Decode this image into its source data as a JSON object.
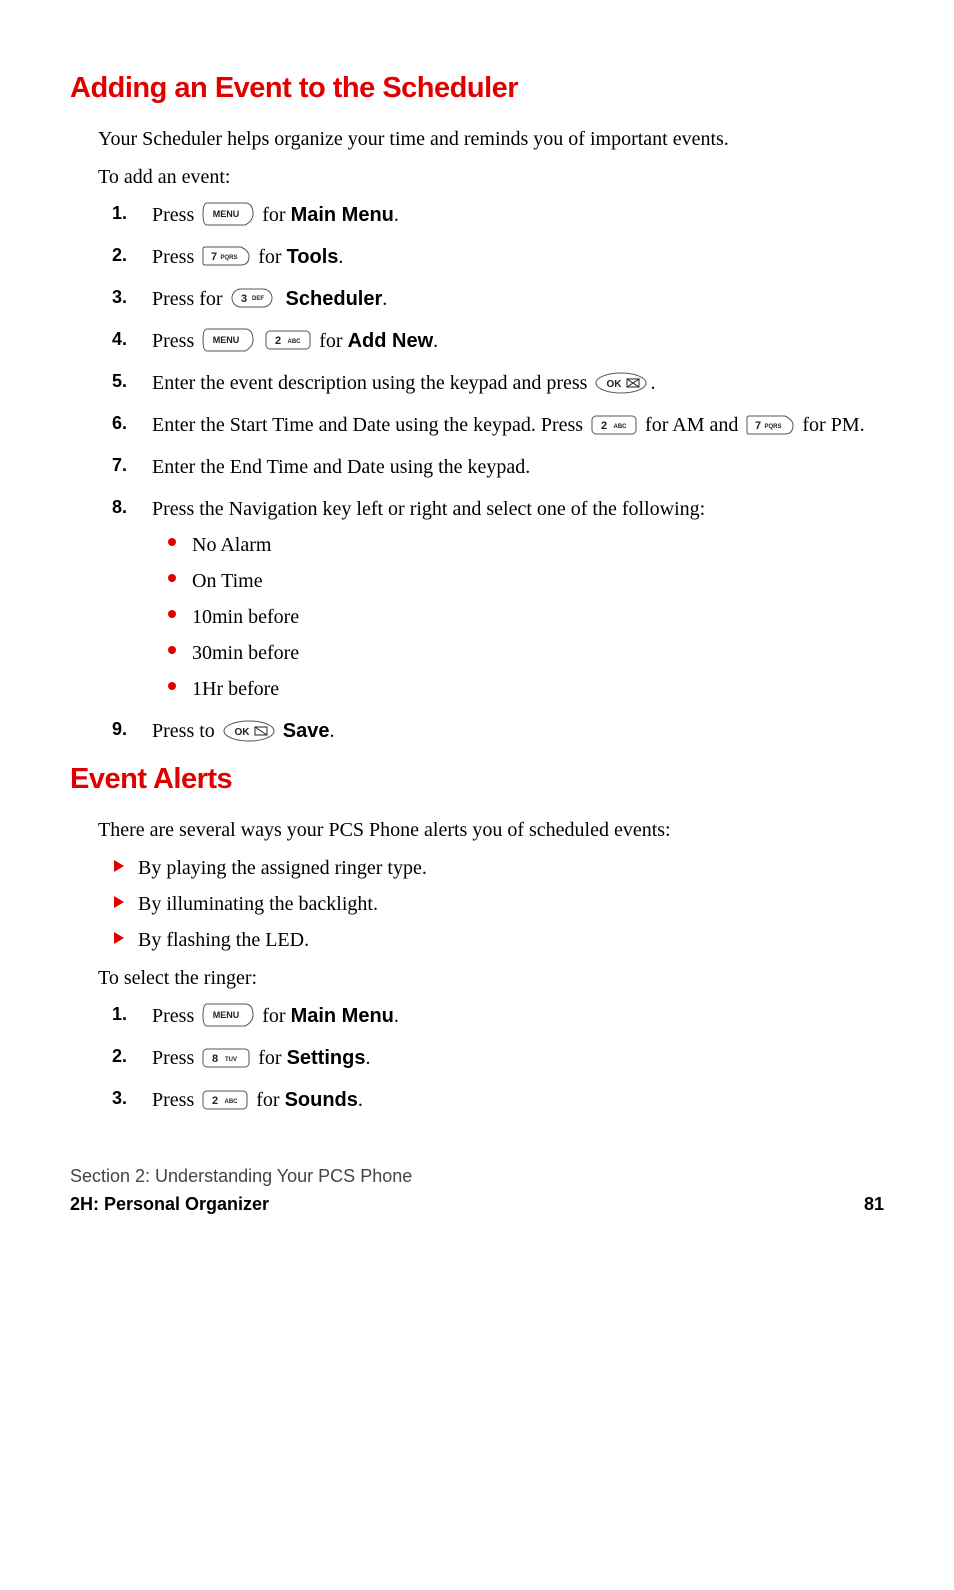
{
  "heading1": "Adding an Event to the Scheduler",
  "intro1": "Your Scheduler helps organize your time and reminds you of important events.",
  "lead1": "To add an event:",
  "steps1": {
    "s1_a": "Press ",
    "s1_b": " for ",
    "s1_bold": "Main Menu",
    "s1_c": ".",
    "s2_a": "Press ",
    "s2_b": " for ",
    "s2_bold": "Tools",
    "s2_c": ".",
    "s3_a": "Press for ",
    "s3_bold": "Scheduler",
    "s3_c": ".",
    "s4_a": "Press ",
    "s4_b": " for ",
    "s4_bold": "Add New",
    "s4_c": ".",
    "s5_a": "Enter the event description using the keypad and press ",
    "s5_c": ".",
    "s6_a": "Enter the Start Time and Date using the keypad. Press ",
    "s6_b": " for AM and ",
    "s6_c": " for PM.",
    "s7": "Enter the End Time and Date using the keypad.",
    "s8": "Press the Navigation key left or right and select one of the following:",
    "s8_opts": [
      "No Alarm",
      "On Time",
      "10min before",
      "30min before",
      "1Hr before"
    ],
    "s9_a": "Press to ",
    "s9_bold": "Save",
    "s9_c": "."
  },
  "nums1": [
    "1.",
    "2.",
    "3.",
    "4.",
    "5.",
    "6.",
    "7.",
    "8.",
    "9."
  ],
  "heading2": "Event Alerts",
  "intro2": "There are several ways your PCS Phone alerts you of scheduled events:",
  "alerts": [
    "By playing the assigned ringer type.",
    "By illuminating the backlight.",
    "By flashing the LED."
  ],
  "lead2": "To select the ringer:",
  "steps2": {
    "s1_a": "Press ",
    "s1_b": " for ",
    "s1_bold": "Main Menu",
    "s1_c": ".",
    "s2_a": "Press ",
    "s2_b": " for ",
    "s2_bold": "Settings",
    "s2_c": ".",
    "s3_a": "Press ",
    "s3_b": " for ",
    "s3_bold": "Sounds",
    "s3_c": "."
  },
  "nums2": [
    "1.",
    "2.",
    "3."
  ],
  "keys": {
    "menu": "MENU",
    "2": "2 ABC",
    "3": "3 DEF",
    "7": "7 PQRS",
    "8": "8 TUV",
    "ok": "OK"
  },
  "footer": {
    "line1": "Section 2: Understanding Your PCS Phone",
    "line2": "2H: Personal Organizer",
    "page": "81"
  }
}
